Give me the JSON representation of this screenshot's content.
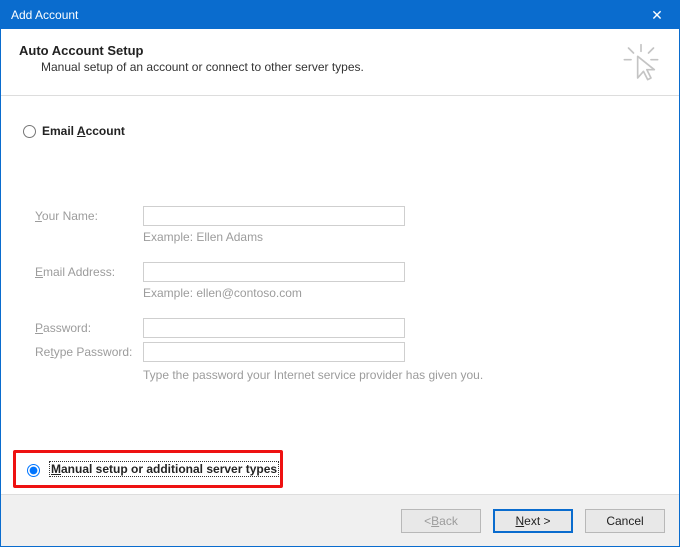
{
  "titlebar": {
    "title": "Add Account",
    "close_glyph": "✕"
  },
  "header": {
    "title": "Auto Account Setup",
    "subtitle": "Manual setup of an account or connect to other server types."
  },
  "options": {
    "email_account_prefix": "Email ",
    "email_account_u": "A",
    "email_account_rest": "ccount",
    "manual_prefix": "",
    "manual_u": "M",
    "manual_rest": "anual setup or additional server types"
  },
  "form": {
    "your_name_u": "Y",
    "your_name_rest": "our Name:",
    "your_name_hint": "Example: Ellen Adams",
    "email_u": "E",
    "email_rest": "mail Address:",
    "email_hint": "Example: ellen@contoso.com",
    "password_u": "P",
    "password_rest": "assword:",
    "retype_prefix": "Re",
    "retype_u": "t",
    "retype_rest": "ype Password:",
    "password_hint": "Type the password your Internet service provider has given you.",
    "your_name_value": "",
    "email_value": "",
    "password_value": "",
    "retype_value": ""
  },
  "buttons": {
    "back_prefix": "< ",
    "back_u": "B",
    "back_rest": "ack",
    "next_u": "N",
    "next_rest": "ext >",
    "cancel": "Cancel"
  }
}
